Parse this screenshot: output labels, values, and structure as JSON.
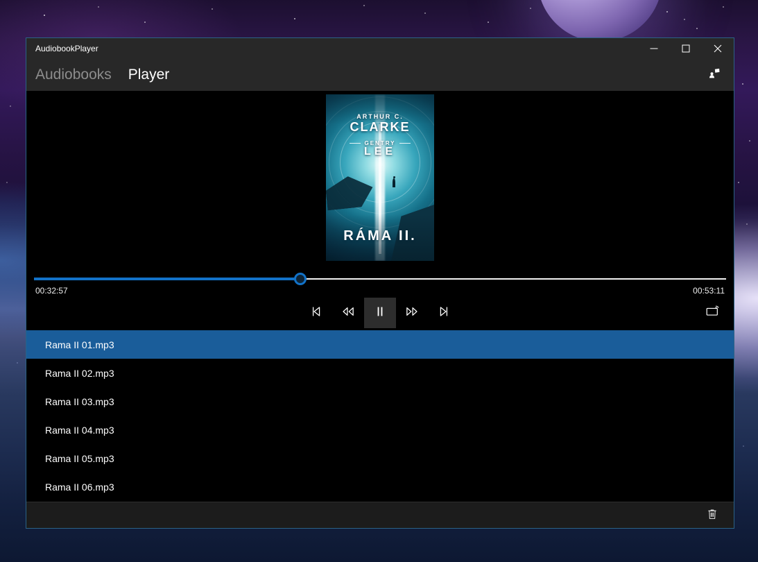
{
  "window": {
    "title": "AudiobookPlayer"
  },
  "nav": {
    "tabs": [
      {
        "label": "Audiobooks",
        "active": false
      },
      {
        "label": "Player",
        "active": true
      }
    ]
  },
  "player": {
    "cover": {
      "author_top": "ARTHUR C.",
      "author_name": "CLARKE",
      "coauthor_top": "GENTRY",
      "coauthor_name": "LEE",
      "title": "RÁMA II."
    },
    "seek": {
      "elapsed": "00:32:57",
      "duration": "00:53:11",
      "progress_percent": 38.5
    },
    "transport": {
      "previous": "previous-track",
      "rewind": "rewind",
      "pause": "pause",
      "fast_forward": "fast-forward",
      "next": "next-track",
      "cast": "cast-to-device"
    }
  },
  "playlist": [
    {
      "label": "Rama II 01.mp3",
      "selected": true
    },
    {
      "label": "Rama II 02.mp3",
      "selected": false
    },
    {
      "label": "Rama II 03.mp3",
      "selected": false
    },
    {
      "label": "Rama II 04.mp3",
      "selected": false
    },
    {
      "label": "Rama II 05.mp3",
      "selected": false
    },
    {
      "label": "Rama II 06.mp3",
      "selected": false
    }
  ],
  "icons": {
    "minimize": "–",
    "maximize": "▢",
    "close": "✕",
    "mini_player": "person-with-square",
    "previous": "|◁",
    "rewind": "◁◁",
    "pause": "❚❚",
    "fast_forward": "▷▷",
    "next": "▷|",
    "cast": "screen-with-waves",
    "trash": "delete-can"
  },
  "colors": {
    "accent_selection": "#1a5d9a",
    "seek_fill": "#1272c8",
    "header_bg": "#282828",
    "window_border": "#2b6286"
  }
}
